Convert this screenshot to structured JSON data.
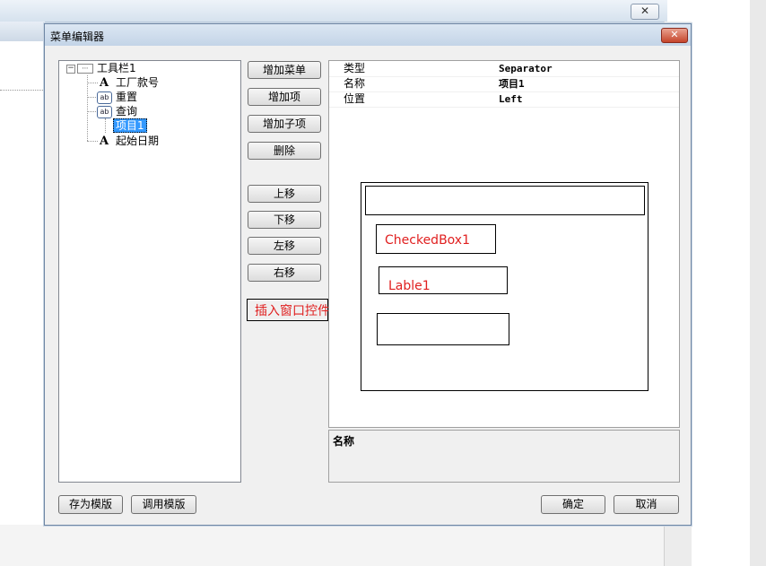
{
  "dialog": {
    "title": "菜单编辑器",
    "close_glyph": "✕"
  },
  "background": {
    "close_glyph": "✕"
  },
  "tree": {
    "root": {
      "label": "工具栏1",
      "icon": "toolbar-icon"
    },
    "items": [
      {
        "label": "工厂款号",
        "icon": "text-label-icon"
      },
      {
        "label": "重置",
        "icon": "button-ab-icon"
      },
      {
        "label": "查询",
        "icon": "button-ab-icon"
      },
      {
        "label": "项目1",
        "icon": "none",
        "selected": true
      },
      {
        "label": "起始日期",
        "icon": "text-label-icon"
      }
    ]
  },
  "buttons": {
    "add_menu": "增加菜单",
    "add_item": "增加项",
    "add_subitem": "增加子项",
    "delete": "删除",
    "move_up": "上移",
    "move_down": "下移",
    "move_left": "左移",
    "move_right": "右移",
    "insert_window_control": "插入窗口控件"
  },
  "properties": [
    {
      "name": "类型",
      "value": "Separator"
    },
    {
      "name": "名称",
      "value": "项目1"
    },
    {
      "name": "位置",
      "value": "Left"
    }
  ],
  "sketch": {
    "checkbox_label": "CheckedBox1",
    "label_label": "Lable1"
  },
  "description": {
    "title": "名称"
  },
  "footer": {
    "save_template": "存为模版",
    "load_template": "调用模版",
    "ok": "确定",
    "cancel": "取消"
  },
  "colors": {
    "annotation": "#e02020",
    "selection": "#3399ff"
  }
}
